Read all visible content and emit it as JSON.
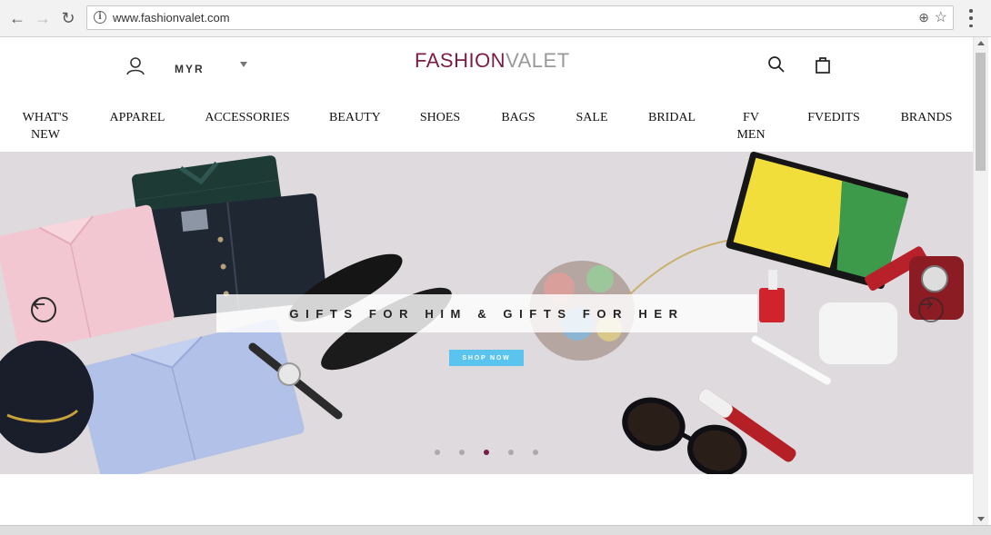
{
  "browser": {
    "url": "www.fashionvalet.com"
  },
  "header": {
    "currency": "MYR",
    "logo": {
      "part1": "FASHION",
      "part2": "VALET"
    }
  },
  "nav": [
    {
      "line1": "WHAT'S",
      "line2": "NEW"
    },
    {
      "line1": "APPAREL",
      "line2": ""
    },
    {
      "line1": "ACCESSORIES",
      "line2": ""
    },
    {
      "line1": "BEAUTY",
      "line2": ""
    },
    {
      "line1": "SHOES",
      "line2": ""
    },
    {
      "line1": "BAGS",
      "line2": ""
    },
    {
      "line1": "SALE",
      "line2": ""
    },
    {
      "line1": "BRIDAL",
      "line2": ""
    },
    {
      "line1": "FV",
      "line2": "MEN"
    },
    {
      "line1": "FVEDITS",
      "line2": ""
    },
    {
      "line1": "BRANDS",
      "line2": ""
    }
  ],
  "hero": {
    "banner": "GIFTS FOR HIM & GIFTS FOR HER",
    "cta": "SHOP NOW",
    "slides_total": 5,
    "active_slide": 3
  },
  "colors": {
    "brand": "#7a1c45",
    "cta": "#5bc4ee"
  }
}
